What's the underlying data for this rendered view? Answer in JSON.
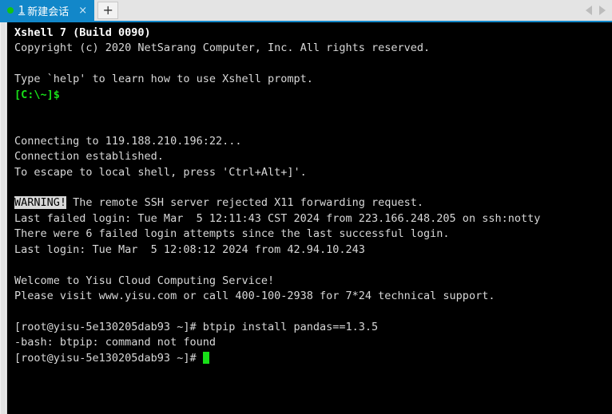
{
  "window": {
    "app_name": "Xshell"
  },
  "tabbar": {
    "tab": {
      "index": "1",
      "title": "新建会话",
      "close_label": "×",
      "status_dot": "connected-green"
    },
    "new_tab_label": "+",
    "nav_prev_icon": "triangle-left-icon",
    "nav_next_icon": "triangle-right-icon"
  },
  "terminal": {
    "lines": [
      {
        "id": "banner-version",
        "text": "Xshell 7 (Build 0090)",
        "style": "bold"
      },
      {
        "id": "banner-copyright",
        "text": "Copyright (c) 2020 NetSarang Computer, Inc. All rights reserved.",
        "style": "white"
      },
      {
        "id": "blank-1",
        "text": "",
        "style": "white"
      },
      {
        "id": "banner-help",
        "text": "Type `help' to learn how to use Xshell prompt.",
        "style": "white"
      },
      {
        "id": "local-prompt",
        "text": "[C:\\~]$",
        "style": "green"
      },
      {
        "id": "blank-2",
        "text": "",
        "style": "white"
      },
      {
        "id": "blank-3",
        "text": "",
        "style": "white"
      },
      {
        "id": "connecting",
        "text": "Connecting to 119.188.210.196:22...",
        "style": "white"
      },
      {
        "id": "connection-ok",
        "text": "Connection established.",
        "style": "white"
      },
      {
        "id": "escape-hint",
        "text": "To escape to local shell, press 'Ctrl+Alt+]'.",
        "style": "white"
      },
      {
        "id": "blank-4",
        "text": "",
        "style": "white"
      },
      {
        "id": "warning-x11",
        "text": " The remote SSH server rejected X11 forwarding request.",
        "style": "warning",
        "badge": "WARNING!"
      },
      {
        "id": "last-failed-login",
        "text": "Last failed login: Tue Mar  5 12:11:43 CST 2024 from 223.166.248.205 on ssh:notty",
        "style": "white"
      },
      {
        "id": "failed-attempts",
        "text": "There were 6 failed login attempts since the last successful login.",
        "style": "white"
      },
      {
        "id": "last-login",
        "text": "Last login: Tue Mar  5 12:08:12 2024 from 42.94.10.243",
        "style": "white"
      },
      {
        "id": "blank-5",
        "text": "",
        "style": "white"
      },
      {
        "id": "motd-welcome",
        "text": "Welcome to Yisu Cloud Computing Service!",
        "style": "white"
      },
      {
        "id": "motd-support",
        "text": "Please visit www.yisu.com or call 400-100-2938 for 7*24 technical support.",
        "style": "white"
      },
      {
        "id": "blank-6",
        "text": "",
        "style": "white"
      },
      {
        "id": "cmd-btpip",
        "text": "[root@yisu-5e130205dab93 ~]# btpip install pandas==1.3.5",
        "style": "white"
      },
      {
        "id": "cmd-error",
        "text": "-bash: btpip: command not found",
        "style": "white"
      },
      {
        "id": "prompt-current",
        "text": "[root@yisu-5e130205dab93 ~]# ",
        "style": "prompt-cursor"
      }
    ]
  },
  "colors": {
    "tab_active_bg": "#1287c9",
    "terminal_bg": "#000000",
    "terminal_fg": "#d8d8d8",
    "prompt_green": "#18e018",
    "cursor_green": "#18e018",
    "status_dot_green": "#13c313"
  }
}
